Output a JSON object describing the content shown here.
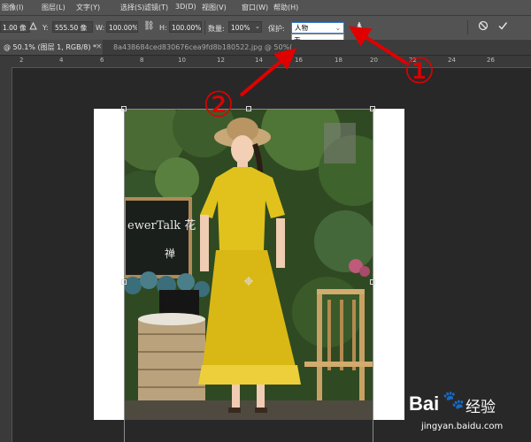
{
  "menubar": {
    "items": [
      "图层(L)",
      "文字(Y)",
      "选择(S)",
      "滤镜(T)",
      "3D(D)",
      "视图(V)",
      "窗口(W)",
      "帮助(H)"
    ],
    "first_item": "图像(I)"
  },
  "options": {
    "x_value": "1.00 像",
    "y_label": "Y:",
    "y_value": "555.50 像",
    "w_label": "W:",
    "w_value": "100.00%",
    "h_label": "H:",
    "h_value": "100.00%",
    "amount_label": "数量:",
    "amount_value": "100%",
    "protect_label": "保护:",
    "protect_value": "人物",
    "protect_options": [
      "无",
      "人物"
    ]
  },
  "tabs": {
    "active": "@ 50.1% (图层 1, RGB/8) *",
    "inactive": "8a438684ced830676cea9fd8b180522.jpg @ 50%(R"
  },
  "ruler": {
    "numbers": [
      "2",
      "4",
      "6",
      "8",
      "10",
      "12",
      "14",
      "16",
      "18",
      "20",
      "22",
      "24",
      "26"
    ]
  },
  "annotations": {
    "marker_one": "①",
    "marker_two": "②"
  },
  "photo": {
    "blackboard_text": "ewerTalk 花",
    "side_text": "禅"
  },
  "watermark": {
    "logo": "Bai",
    "logo_tail": "百",
    "sub": "经验",
    "url": "jingyan.baidu.com"
  },
  "colors": {
    "arrow_red": "#e00000",
    "dress_yellow": "#e1c21c",
    "foliage": "#3b5a2a",
    "selection_blue": "#2f7ad1"
  }
}
